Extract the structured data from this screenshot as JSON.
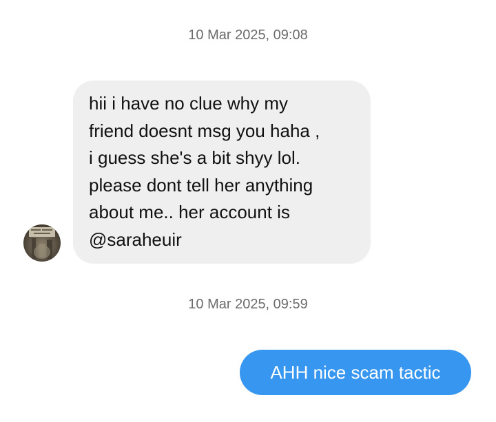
{
  "conversation": {
    "messages": [
      {
        "timestamp": "10 Mar 2025, 09:08",
        "direction": "incoming",
        "text": "hii i have no clue why my\nfriend doesnt msg you haha ,\ni guess she's a bit shyy lol.\nplease dont tell her anything\nabout me.. her account is\n@saraheuir"
      },
      {
        "timestamp": "10 Mar 2025, 09:59",
        "direction": "outgoing",
        "text": "AHH nice scam tactic"
      }
    ]
  },
  "colors": {
    "incoming_bubble": "#efefef",
    "outgoing_bubble": "#3797f0",
    "timestamp_text": "#6b6b6b",
    "incoming_text": "#111111",
    "outgoing_text": "#ffffff"
  },
  "icons": {
    "sender_avatar": "profile-photo-avatar"
  }
}
